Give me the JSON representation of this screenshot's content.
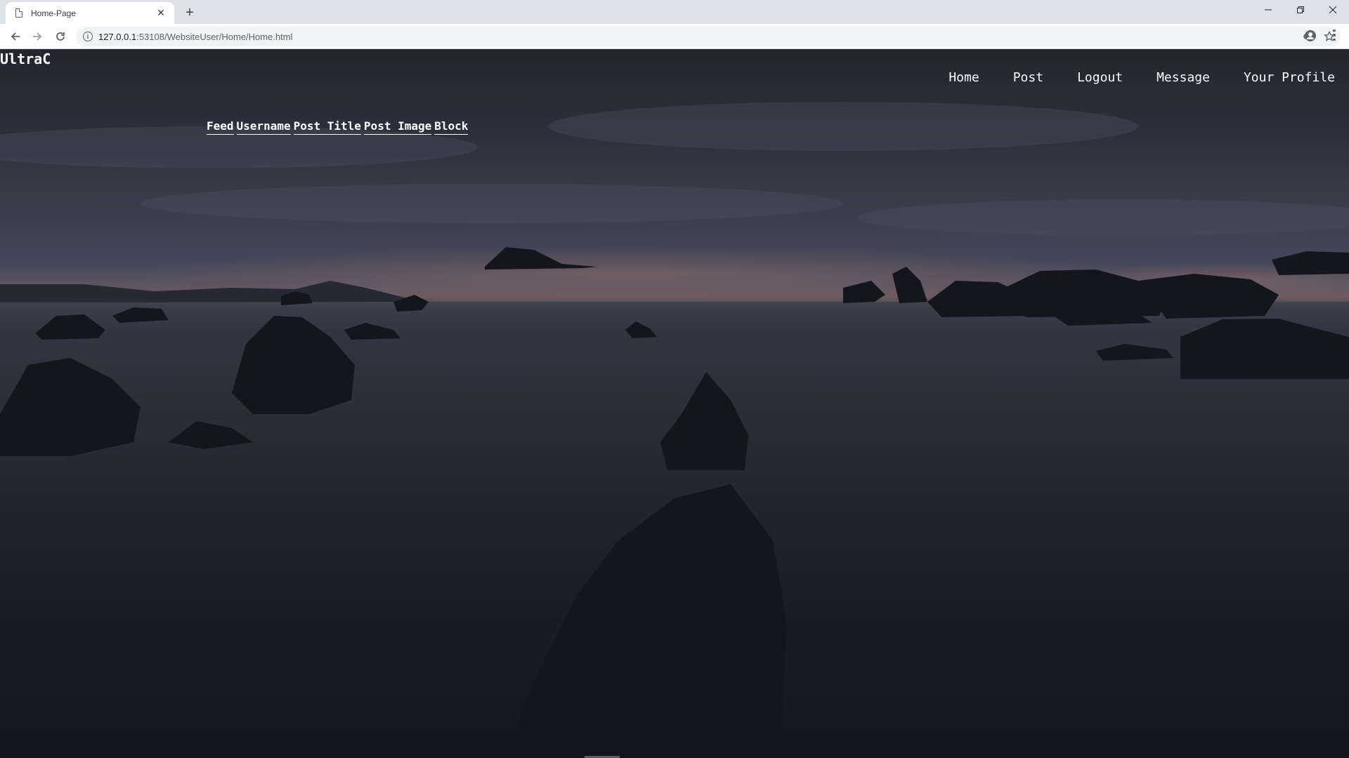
{
  "browser": {
    "tab_title": "Home-Page",
    "tab_close": "✕",
    "new_tab": "+",
    "url_host": "127.0.0.1",
    "url_rest": ":53108/WebsiteUser/Home/Home.html",
    "window_controls": {
      "minimize": "—",
      "restore": "❐",
      "close": "✕"
    }
  },
  "page": {
    "brand": "UltraC",
    "nav": [
      {
        "label": "Home"
      },
      {
        "label": "Post"
      },
      {
        "label": "Logout"
      },
      {
        "label": "Message"
      },
      {
        "label": "Your Profile"
      }
    ],
    "feed_table": {
      "headers": [
        "Feed",
        "Username",
        "Post Title",
        "Post Image",
        "Block"
      ]
    }
  },
  "colors": {
    "sky_top": "#23252f",
    "horizon_glow": "#6e5b60",
    "sea": "#1f212a",
    "text": "#ffffff"
  }
}
